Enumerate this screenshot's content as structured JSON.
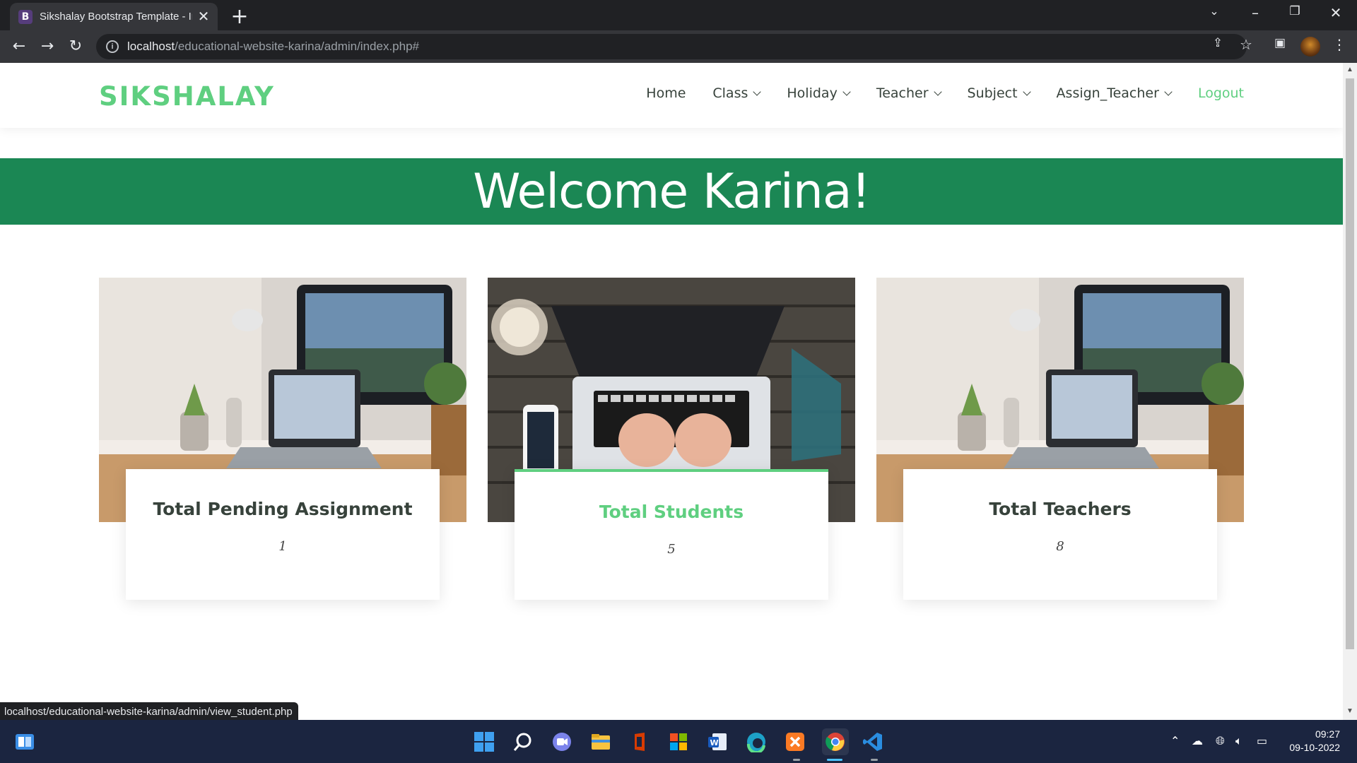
{
  "browser": {
    "tab_title": "Sikshalay Bootstrap Template - In",
    "tab_favicon": "B",
    "url_host": "localhost",
    "url_path": "/educational-website-karina/admin/index.php#",
    "status_url": "localhost/educational-website-karina/admin/view_student.php"
  },
  "site": {
    "logo": "SIKSHALAY",
    "nav": [
      {
        "label": "Home"
      },
      {
        "label": "Class"
      },
      {
        "label": "Holiday"
      },
      {
        "label": "Teacher"
      },
      {
        "label": "Subject"
      },
      {
        "label": "Assign_Teacher"
      },
      {
        "label": "Logout"
      }
    ],
    "welcome": "Welcome Karina!",
    "cards": [
      {
        "title": "Total Pending Assignment",
        "value": "1"
      },
      {
        "title": "Total Students",
        "value": "5"
      },
      {
        "title": "Total Teachers",
        "value": "8"
      }
    ]
  },
  "colors": {
    "accent": "#5fcf80",
    "banner": "#1b8754",
    "text": "#37423b"
  },
  "taskbar": {
    "time": "09:27",
    "date": "09-10-2022"
  }
}
